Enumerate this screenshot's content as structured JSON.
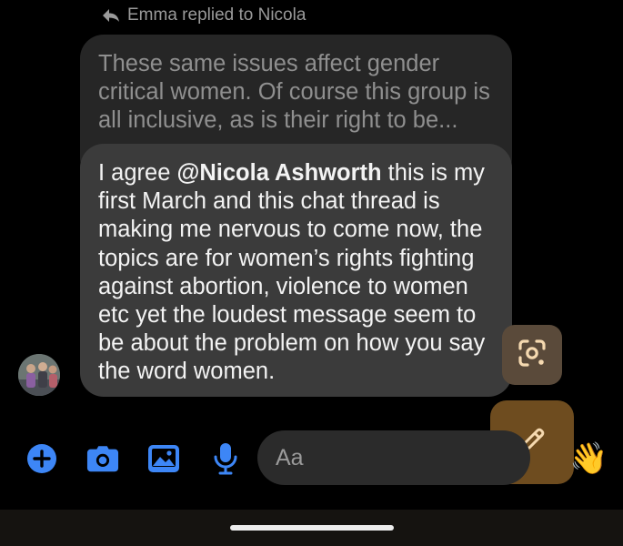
{
  "reply_header": {
    "text": "Emma replied to Nicola"
  },
  "quoted_message": {
    "text": "These same issues affect gender critical women. Of course this group is all inclusive, as is their right to be..."
  },
  "message": {
    "prefix": "I agree ",
    "mention": "@Nicola Ashworth",
    "body": "  this is my first March and this chat thread is making me nervous to come now, the topics are for women’s rights fighting against abortion, violence to women etc yet the loudest message seem to be about the problem on how you say the word women."
  },
  "composer": {
    "placeholder": "Aa",
    "tools": [
      "plus-icon",
      "camera-icon",
      "gallery-icon",
      "microphone-icon"
    ],
    "reaction_emoji": "👋"
  },
  "colors": {
    "accent_blue": "#3d86f6",
    "bubble_quoted": "#262626",
    "bubble_message": "#3b3b3b",
    "fab_brown": "#6e4c1f",
    "lens_brown": "#5a4a3a",
    "icon_cream": "#f5d9b0"
  }
}
